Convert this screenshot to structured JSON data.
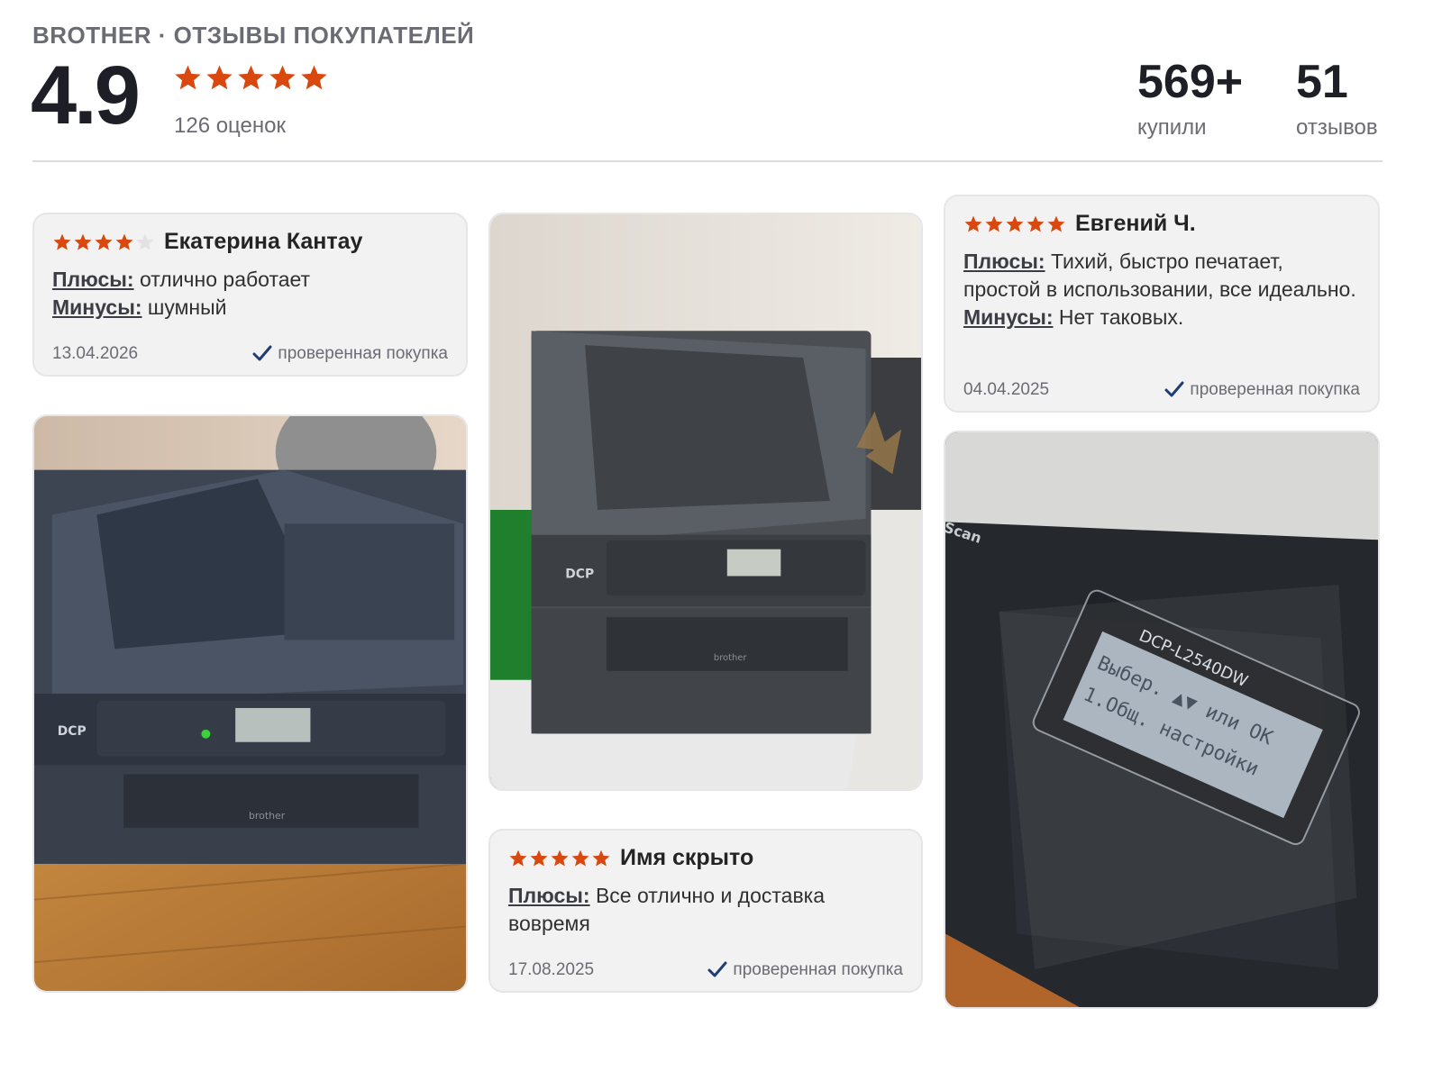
{
  "header": {
    "brand_title": "BROTHER · ОТЗЫВЫ ПОКУПАТЕЛЕЙ",
    "rating": "4.9",
    "rating_stars": 5,
    "rating_count": "126 оценок",
    "bought_value": "569+",
    "bought_label": "купили",
    "reviews_value": "51",
    "reviews_label": "отзывов"
  },
  "colors": {
    "star_filled": "#d9480f",
    "star_empty": "#e2e2e4",
    "check": "#1f3d73",
    "card_bg": "#f2f2f3"
  },
  "reviews": [
    {
      "stars": 4,
      "author": "Екатерина Кантау",
      "pros_label": "Плюсы:",
      "pros": "отлично работает",
      "cons_label": "Минусы:",
      "cons": "шумный",
      "date": "13.04.2026",
      "verified": "проверенная покупка"
    },
    {
      "stars": 5,
      "author": "Евгений Ч.",
      "pros_label": "Плюсы:",
      "pros": "Тихий, быстро печатает, простой в использовании, все идеально.",
      "cons_label": "Минусы:",
      "cons": "Нет таковых.",
      "date": "04.04.2025",
      "verified": "проверенная покупка"
    },
    {
      "stars": 5,
      "author": "Имя скрыто",
      "pros_label": "Плюсы:",
      "pros": "Все отлично и доставка вовремя",
      "date": "17.08.2025",
      "verified": "проверенная покупка"
    }
  ],
  "photos": {
    "photo1": {
      "model_text": "DCP",
      "brand_text": "brother"
    },
    "photo2": {
      "model_text": "DCP",
      "brand_text": "brother"
    },
    "photo3": {
      "scan_text": "Scan",
      "model_text": "DCP-L2540DW",
      "lcd_line1": "Выбер. ▲▼ или OK",
      "lcd_line2": "1.Общ. настройки"
    }
  }
}
